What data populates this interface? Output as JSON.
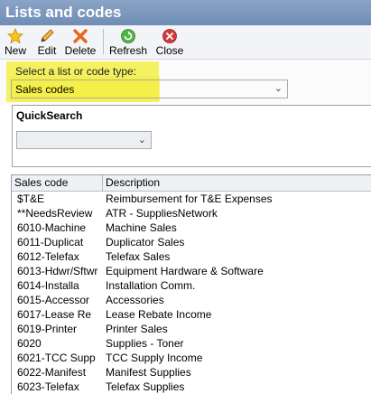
{
  "window": {
    "title": "Lists and codes"
  },
  "toolbar": {
    "new_label": "New",
    "edit_label": "Edit",
    "delete_label": "Delete",
    "refresh_label": "Refresh",
    "close_label": "Close"
  },
  "selector": {
    "label": "Select a list or code type:",
    "value": "Sales codes"
  },
  "quicksearch": {
    "title": "QuickSearch",
    "value": ""
  },
  "table": {
    "columns": [
      "Sales code",
      "Description"
    ],
    "rows": [
      [
        "$T&E",
        "Reimbursement for T&E Expenses"
      ],
      [
        "**NeedsReview",
        "ATR - SuppliesNetwork"
      ],
      [
        "6010-Machine",
        "Machine Sales"
      ],
      [
        "6011-Duplicat",
        "Duplicator Sales"
      ],
      [
        "6012-Telefax",
        "Telefax Sales"
      ],
      [
        "6013-Hdwr/Sftwr",
        "Equipment Hardware & Software"
      ],
      [
        "6014-Installa",
        "Installation Comm."
      ],
      [
        "6015-Accessor",
        "Accessories"
      ],
      [
        "6017-Lease Re",
        "Lease Rebate Income"
      ],
      [
        "6019-Printer",
        "Printer Sales"
      ],
      [
        "6020",
        "Supplies - Toner"
      ],
      [
        "6021-TCC Supp",
        "TCC Supply Income"
      ],
      [
        "6022-Manifest",
        "Manifest Supplies"
      ],
      [
        "6023-Telefax",
        "Telefax Supplies"
      ]
    ]
  },
  "icons": {
    "new": "star-icon",
    "edit": "pencil-icon",
    "delete": "red-x-icon",
    "refresh": "refresh-icon",
    "close": "close-circle-icon"
  },
  "colors": {
    "title_bar": "#7794bb",
    "highlight": "#f3f046",
    "delete_icon": "#e8661a",
    "refresh_icon": "#3aa63a",
    "close_icon": "#d23b3b"
  }
}
